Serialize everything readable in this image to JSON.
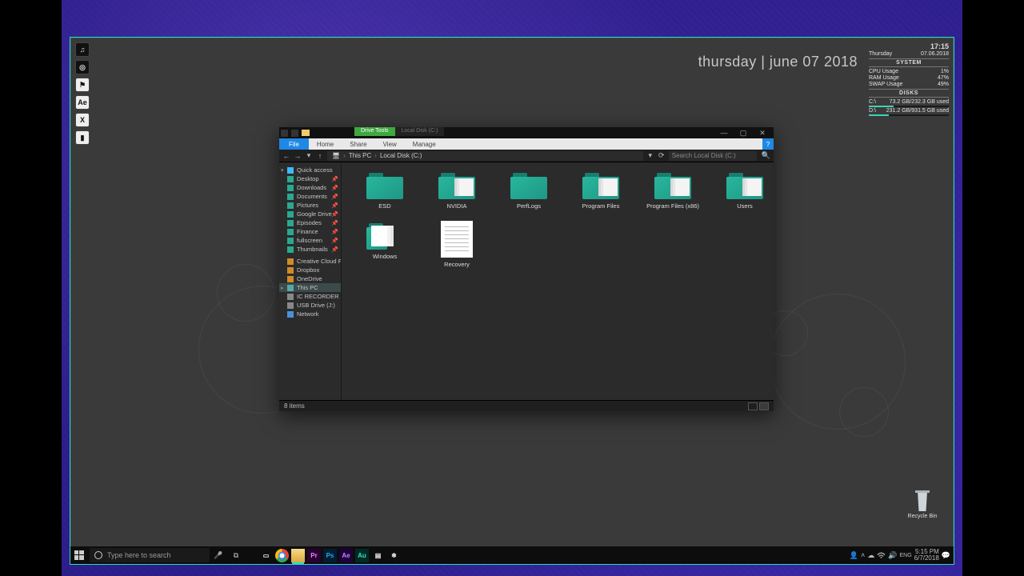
{
  "clock": {
    "text": "thursday | june 07 2018"
  },
  "monitor": {
    "time": "17:15",
    "day": "Thursday",
    "date": "07.06.2018",
    "system_label": "SYSTEM",
    "cpu": {
      "label": "CPU Usage",
      "value": "1%",
      "pct": 1
    },
    "ram": {
      "label": "RAM Usage",
      "value": "47%",
      "pct": 47
    },
    "swap": {
      "label": "SWAP Usage",
      "value": "49%",
      "pct": 49
    },
    "disks_label": "DISKS",
    "disks": [
      {
        "drive": "C:\\",
        "text": "73.2 GB/232.3 GB used",
        "pct": 31
      },
      {
        "drive": "D:\\",
        "text": "231.2 GB/931.5 GB used",
        "pct": 25
      }
    ]
  },
  "desktop_icons": [
    {
      "name": "itunes",
      "glyph": "♫"
    },
    {
      "name": "chrome-canary",
      "glyph": "◎"
    },
    {
      "name": "discord",
      "glyph": "⚑"
    },
    {
      "name": "after-effects",
      "glyph": "Ae"
    },
    {
      "name": "excel",
      "glyph": "X"
    },
    {
      "name": "library",
      "glyph": "▮"
    }
  ],
  "recycle": {
    "label": "Recycle Bin"
  },
  "taskbar": {
    "search_placeholder": "Type here to search",
    "pins": [
      {
        "name": "task-view",
        "glyph": "▭"
      },
      {
        "name": "chrome",
        "cls": "ch",
        "glyph": ""
      },
      {
        "name": "explorer",
        "cls": "explorer active",
        "glyph": ""
      },
      {
        "name": "premiere",
        "cls": "pr",
        "glyph": "Pr"
      },
      {
        "name": "photoshop",
        "cls": "ps",
        "glyph": "Ps"
      },
      {
        "name": "after-effects",
        "cls": "ae",
        "glyph": "Ae"
      },
      {
        "name": "audition",
        "cls": "au",
        "glyph": "Au"
      },
      {
        "name": "notes",
        "glyph": "▤"
      },
      {
        "name": "rainmeter",
        "glyph": "❄"
      }
    ],
    "tray": {
      "time": "5:15 PM",
      "date": "6/7/2018"
    }
  },
  "explorer": {
    "drive_tools_tab": "Drive Tools",
    "location_tab": "Local Disk (C:)",
    "ribbon": {
      "file": "File",
      "tabs": [
        "Home",
        "Share",
        "View",
        "Manage"
      ]
    },
    "address": {
      "crumb_root": "This PC",
      "crumb_leaf": "Local Disk (C:)",
      "search_placeholder": "Search Local Disk (C:)"
    },
    "sidebar": {
      "quick": "Quick access",
      "pinned": [
        "Desktop",
        "Downloads",
        "Documents",
        "Pictures",
        "Google Drive",
        "Episodes",
        "Finance",
        "fullscreen",
        "Thumbnails"
      ],
      "items": [
        "Creative Cloud Files",
        "Dropbox",
        "OneDrive"
      ],
      "this_pc": "This PC",
      "drives": [
        "IC RECORDER (M:)",
        "USB Drive (J:)"
      ],
      "network": "Network"
    },
    "folders": [
      {
        "name": "ESD",
        "variant": ""
      },
      {
        "name": "NVIDIA",
        "variant": "docs"
      },
      {
        "name": "PerfLogs",
        "variant": ""
      },
      {
        "name": "Program Files",
        "variant": "docs"
      },
      {
        "name": "Program Files (x86)",
        "variant": "docs"
      },
      {
        "name": "Users",
        "variant": "docs"
      },
      {
        "name": "Windows",
        "variant": "win"
      }
    ],
    "files": [
      {
        "name": "Recovery",
        "type": "doc"
      }
    ],
    "status": "8 items"
  }
}
